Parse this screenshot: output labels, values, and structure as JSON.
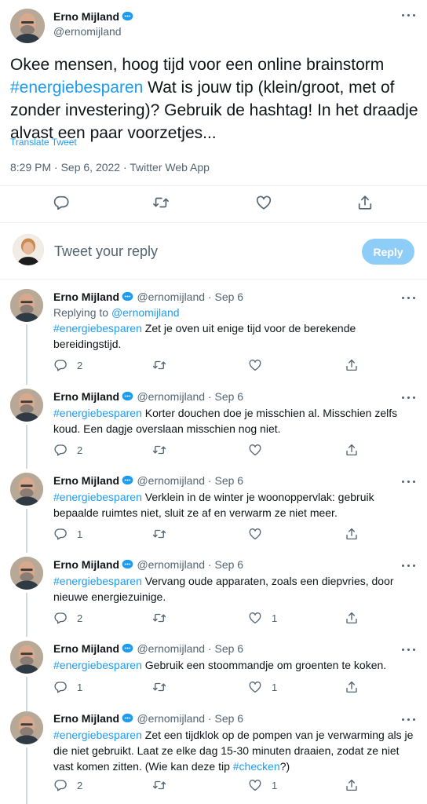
{
  "main_tweet": {
    "author": "Erno Mijland",
    "handle": "@ernomijland",
    "hashtag": "#energiebesparen",
    "text_before": "Okee mensen, hoog tijd voor een online brainstorm ",
    "text_after": " Wat is jouw tip (klein/groot, met of zonder investering)? Gebruik de hashtag! In het draadje alvast een paar voorzetjes...",
    "translate_label": "Translate Tweet",
    "meta": "8:29 PM · Sep 6, 2022 · Twitter Web App"
  },
  "compose": {
    "placeholder": "Tweet your reply",
    "button_label": "Reply"
  },
  "replies": [
    {
      "author": "Erno Mijland",
      "handle_date": "@ernomijland · Sep 6",
      "replying_prefix": "Replying to ",
      "replying_to": "@ernomijland",
      "hashtag": "#energiebesparen",
      "text": " Zet je oven uit enige tijd voor de berekende bereidingstijd.",
      "replies": "2",
      "retweets": "",
      "likes": ""
    },
    {
      "author": "Erno Mijland",
      "handle_date": "@ernomijland · Sep 6",
      "hashtag": "#energiebesparen",
      "text": " Korter douchen doe je misschien al. Misschien zelfs koud. Een dagje overslaan misschien nog niet.",
      "replies": "2",
      "retweets": "",
      "likes": ""
    },
    {
      "author": "Erno Mijland",
      "handle_date": "@ernomijland · Sep 6",
      "hashtag": "#energiebesparen",
      "text": " Verklein in de winter je woonoppervlak: gebruik bepaalde ruimtes niet, sluit ze af en verwarm ze niet meer.",
      "replies": "1",
      "retweets": "",
      "likes": ""
    },
    {
      "author": "Erno Mijland",
      "handle_date": "@ernomijland · Sep 6",
      "hashtag": "#energiebesparen",
      "text": " Vervang oude apparaten, zoals een diepvries, door nieuwe energiezuinige.",
      "replies": "2",
      "retweets": "",
      "likes": "1"
    },
    {
      "author": "Erno Mijland",
      "handle_date": "@ernomijland · Sep 6",
      "hashtag": "#energiebesparen",
      "text": " Gebruik een stoommandje om groenten te koken.",
      "replies": "1",
      "retweets": "",
      "likes": "1"
    },
    {
      "author": "Erno Mijland",
      "handle_date": "@ernomijland · Sep 6",
      "hashtag": "#energiebesparen",
      "text": " Zet een tijdklok op de pompen van je verwarming als je die niet gebruikt. Laat ze elke dag 15-30 minuten draaien, zodat ze niet vast komen zitten. (Wie kan deze tip ",
      "hashtag2": "#checken",
      "text2": "?)",
      "replies": "2",
      "retweets": "",
      "likes": "1"
    }
  ],
  "colors": {
    "accent": "#1d9bf0",
    "reply_button": "#8ecdf8",
    "secondary_text": "#536471",
    "divider": "#eff3f4"
  },
  "icons": [
    "verified-badge-icon",
    "more-options-icon",
    "reply-icon",
    "retweet-icon",
    "like-icon",
    "share-icon"
  ]
}
